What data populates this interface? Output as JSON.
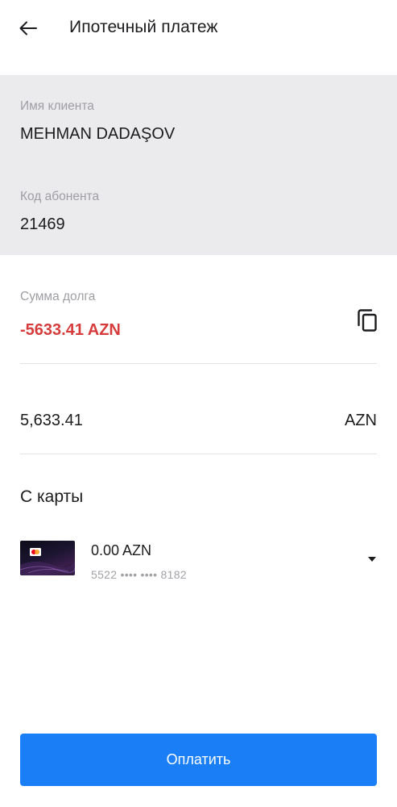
{
  "header": {
    "title": "Ипотечный платеж",
    "back_icon": "arrow-left-icon"
  },
  "client": {
    "name_label": "Имя клиента",
    "name_value": "MEHMAN DADAŞOV",
    "subscriber_label": "Код абонента",
    "subscriber_value": "21469"
  },
  "debt": {
    "label": "Сумма долга",
    "value": "-5633.41 AZN",
    "copy_icon": "copy-icon"
  },
  "amount": {
    "value": "5,633.41",
    "currency": "AZN"
  },
  "source": {
    "title": "С карты",
    "card_balance": "0.00 AZN",
    "card_number": "5522 •••• •••• 8182",
    "dropdown_icon": "caret-down-icon"
  },
  "actions": {
    "pay_label": "Оплатить"
  },
  "colors": {
    "accent": "#1a7ff6",
    "debt_red": "#d63c3c",
    "info_bg": "#ebebed"
  }
}
